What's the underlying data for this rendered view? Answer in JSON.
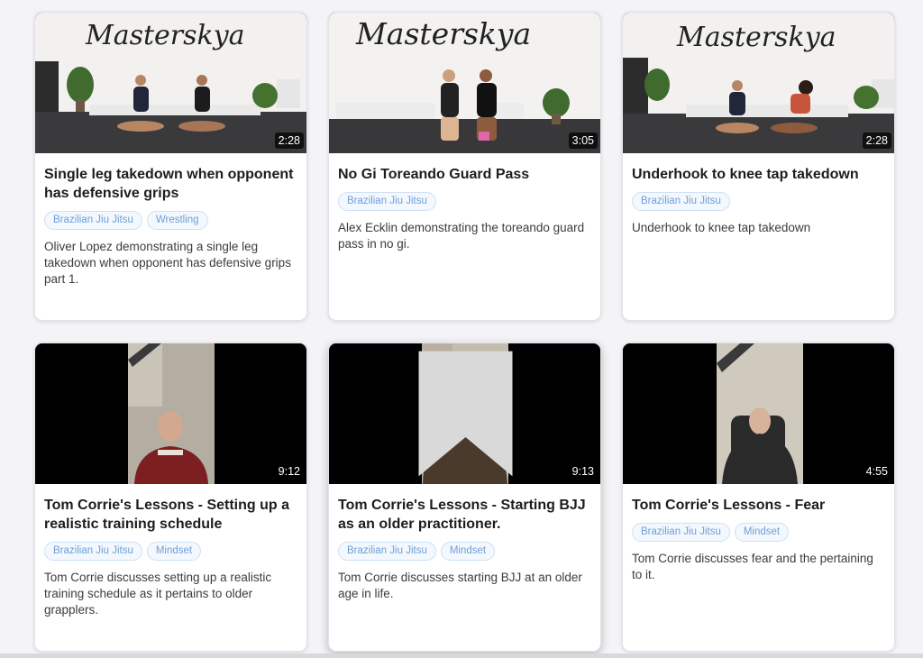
{
  "cards": [
    {
      "title": "Single leg takedown when opponent has defensive grips",
      "duration": "2:28",
      "tags": [
        "Brazilian Jiu Jitsu",
        "Wrestling"
      ],
      "description": "Oliver Lopez demonstrating a single leg takedown when opponent has defensive grips part 1.",
      "thumbnail_logo": "Masterskya"
    },
    {
      "title": "No Gi Toreando Guard Pass",
      "duration": "3:05",
      "tags": [
        "Brazilian Jiu Jitsu"
      ],
      "description": "Alex Ecklin demonstrating the toreando guard pass in no gi.",
      "thumbnail_logo": "Masterskya"
    },
    {
      "title": "Underhook to knee tap takedown",
      "duration": "2:28",
      "tags": [
        "Brazilian Jiu Jitsu"
      ],
      "description": "Underhook to knee tap takedown",
      "thumbnail_logo": "Masterskya"
    },
    {
      "title": "Tom Corrie's Lessons - Setting up a realistic training schedule",
      "duration": "9:12",
      "tags": [
        "Brazilian Jiu Jitsu",
        "Mindset"
      ],
      "description": "Tom Corrie discusses setting up a realistic training schedule as it pertains to older grapplers."
    },
    {
      "title": "Tom Corrie's Lessons - Starting BJJ as an older practitioner.",
      "duration": "9:13",
      "tags": [
        "Brazilian Jiu Jitsu",
        "Mindset"
      ],
      "description": "Tom Corrie discusses starting BJJ at an older age in life."
    },
    {
      "title": "Tom Corrie's Lessons - Fear",
      "duration": "4:55",
      "tags": [
        "Brazilian Jiu Jitsu",
        "Mindset"
      ],
      "description": "Tom Corrie discusses fear and the pertaining to it."
    }
  ],
  "colors": {
    "tag_text": "#6e9fd6",
    "tag_border": "#cfe0f3",
    "page_bg": "#f4f4f7"
  },
  "icons": [
    "bookmark-icon"
  ]
}
